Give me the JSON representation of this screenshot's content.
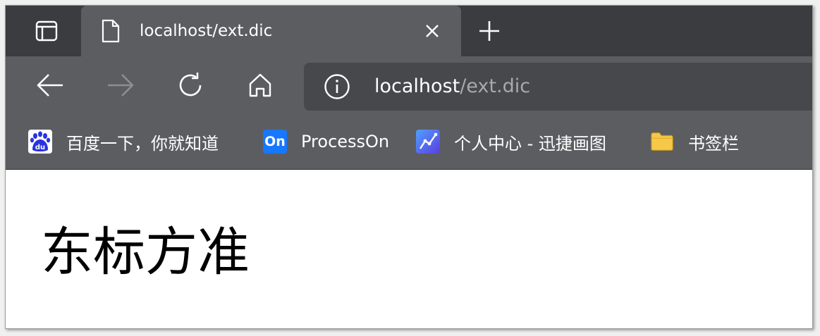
{
  "tabs": {
    "active": {
      "title": "localhost/ext.dic",
      "favicon": "page-icon"
    },
    "icons": {
      "tab_actions": "tab-actions-icon",
      "close": "close-icon",
      "new_tab": "plus-icon"
    }
  },
  "toolbar": {
    "icons": [
      "back-arrow-icon",
      "forward-arrow-icon",
      "refresh-icon",
      "home-icon"
    ],
    "forward_enabled": false
  },
  "address_bar": {
    "icon": "info-icon",
    "host": "localhost",
    "path": "/ext.dic"
  },
  "bookmarks": [
    {
      "label": "百度一下，你就知道",
      "icon": "baidu-icon",
      "icon_text": "du",
      "color": "#2932e1"
    },
    {
      "label": "ProcessOn",
      "icon": "processon-icon",
      "icon_text": "On",
      "color": "#1677ff"
    },
    {
      "label": "个人中心 - 迅捷画图",
      "icon": "xunjie-chart-icon",
      "color": "#3d7cf5"
    },
    {
      "label": "书签栏",
      "icon": "folder-icon",
      "color": "#f5c84a"
    }
  ],
  "page": {
    "text": "东标方准"
  },
  "colors": {
    "tab_strip": "#3b3c40",
    "toolbar": "#5c5d61",
    "address_field": "#47484c",
    "url_path": "#a8a9ac"
  }
}
